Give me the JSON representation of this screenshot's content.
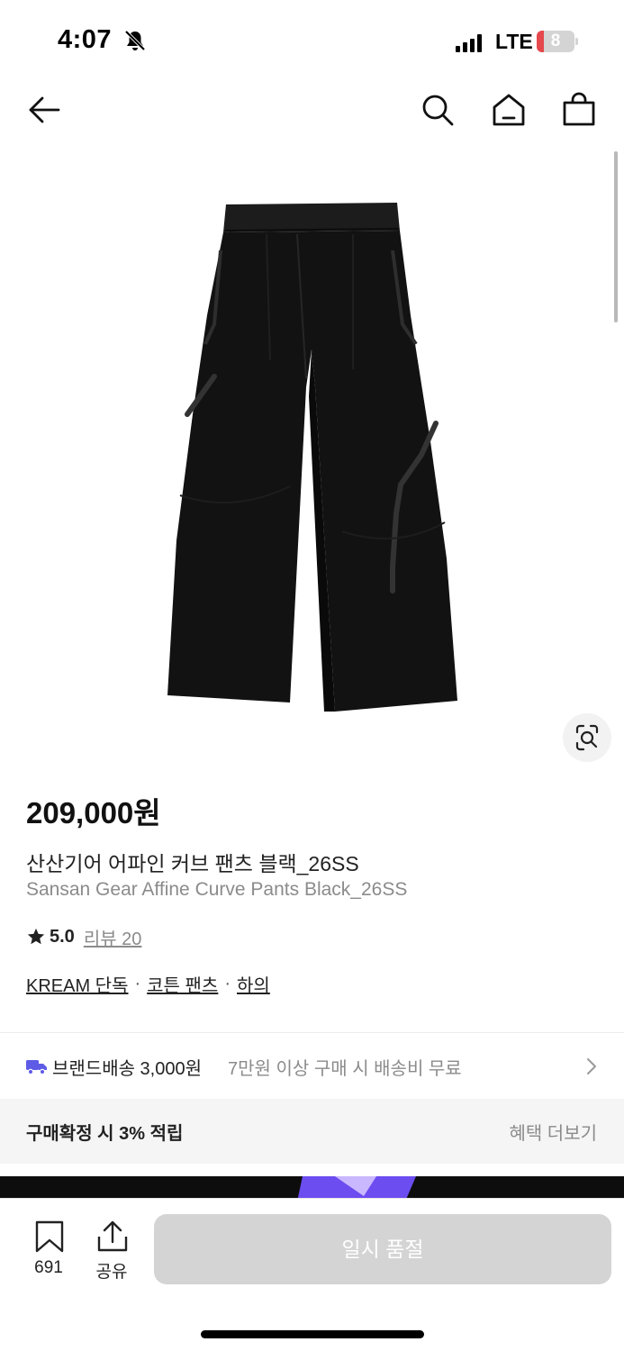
{
  "status_bar": {
    "time": "4:07",
    "network": "LTE",
    "battery_level": "8",
    "battery_fraction": 0.08,
    "battery_color": "#e5484d"
  },
  "nav": {
    "icons": [
      "back-arrow-icon",
      "search-icon",
      "home-icon",
      "shopping-bag-icon"
    ]
  },
  "product": {
    "image_icon": "pants-image",
    "lens_icon": "lens-search-icon",
    "price": "209,000원",
    "name_ko": "산산기어 어파인 커브 팬츠 블랙_26SS",
    "name_en": "Sansan Gear Affine Curve Pants Black_26SS",
    "rating": "5.0",
    "review_label": "리뷰 20",
    "tags": [
      "KREAM 단독",
      "코튼 팬츠",
      "하의"
    ],
    "tag_separator": "·"
  },
  "shipping": {
    "icon": "truck-icon",
    "icon_color": "#5e5ce6",
    "label": "브랜드배송 3,000원",
    "condition": "7만원 이상 구매 시 배송비 무료"
  },
  "benefit": {
    "title": "구매확정 시 3% 적립",
    "link": "혜택 더보기"
  },
  "bottom_bar": {
    "wish_count": "691",
    "share_label": "공유",
    "action_label": "일시 품절",
    "action_color": "#d4d4d4"
  }
}
